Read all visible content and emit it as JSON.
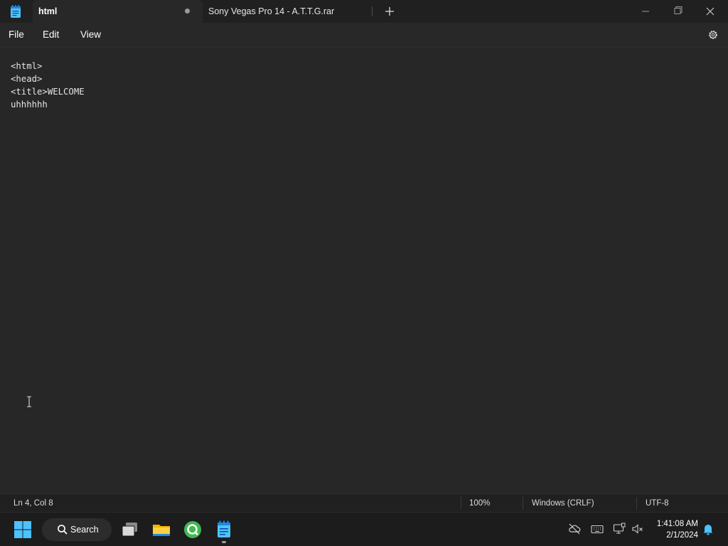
{
  "window": {
    "app_icon": "notepad-icon",
    "tabs": [
      {
        "label": "html",
        "active": true,
        "modified": true
      },
      {
        "label": "Sony Vegas Pro 14 - A.T.T.G.rar",
        "active": false,
        "modified": false
      }
    ],
    "new_tab_icon": "plus-icon",
    "controls": [
      "minimize-icon",
      "maximize-icon",
      "close-icon"
    ]
  },
  "menu": {
    "items": [
      "File",
      "Edit",
      "View"
    ],
    "settings_icon": "gear-icon"
  },
  "editor": {
    "lines": [
      "<html>",
      "<head>",
      "<title>WELCOME",
      "uhhhhhh"
    ]
  },
  "status": {
    "position": "Ln 4, Col 8",
    "zoom": "100%",
    "line_ending": "Windows (CRLF)",
    "encoding": "UTF-8"
  },
  "taskbar": {
    "start_icon": "windows-logo-icon",
    "search_label": "Search",
    "apps": [
      "task-view-icon",
      "file-explorer-icon",
      "qbittorrent-icon",
      "notepad-icon"
    ],
    "tray": [
      "onedrive-off-icon",
      "keyboard-icon",
      "network-icon",
      "volume-muted-icon",
      "notifications-icon"
    ],
    "time": "1:41:08 AM",
    "date": "2/1/2024"
  },
  "colors": {
    "editor_bg": "#272727",
    "titlebar_bg": "#202020",
    "taskbar_bg": "#1c1c1c",
    "accent": "#4cc2ff"
  }
}
